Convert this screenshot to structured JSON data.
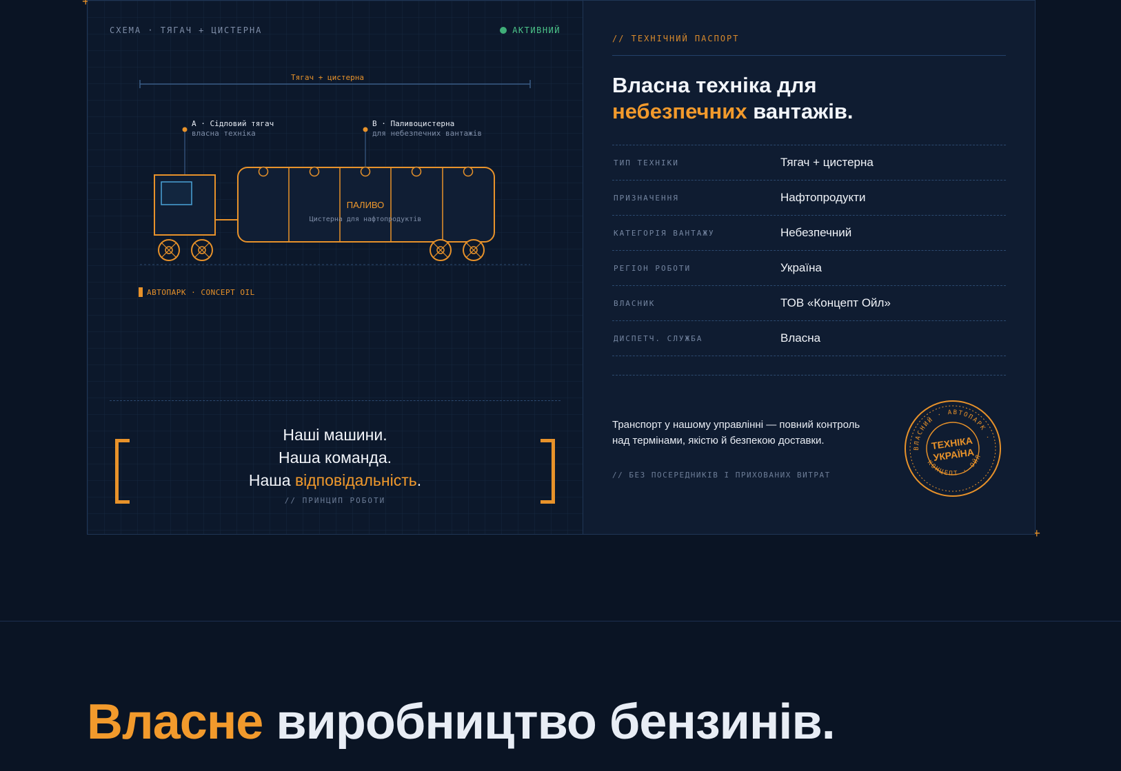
{
  "schema": {
    "label": "СХЕМА · ТЯГАЧ + ЦИСТЕРНА",
    "status": "АКТИВНИЙ",
    "span_label": "Тягач + цистерна",
    "callout_a_title": "A · Сідловий тягач",
    "callout_a_sub": "власна техніка",
    "callout_b_title": "B · Паливоцистерна",
    "callout_b_sub": "для небезпечних вантажів",
    "tank_title": "ПАЛИВО",
    "tank_sub": "Цистерна для нафтопродуктів",
    "fleet_tag": "АВТОПАРК · CONCEPT OIL"
  },
  "motto": {
    "line1": "Наші машини.",
    "line2": "Наша команда.",
    "line3_prefix": "Наша ",
    "line3_accent": "відповідальність",
    "line3_suffix": ".",
    "sub": "// ПРИНЦИП РОБОТИ"
  },
  "passport": {
    "tag": "// ТЕХНІЧНИЙ ПАСПОРТ",
    "heading_line1": "Власна техніка для",
    "heading_accent": "небезпечних",
    "heading_rest": " вантажів.",
    "specs": [
      {
        "key": "ТИП ТЕХНІКИ",
        "value": "Тягач + цистерна"
      },
      {
        "key": "ПРИЗНАЧЕННЯ",
        "value": "Нафтопродукти"
      },
      {
        "key": "КАТЕГОРІЯ ВАНТАЖУ",
        "value": "Небезпечний"
      },
      {
        "key": "РЕГІОН РОБОТИ",
        "value": "Україна"
      },
      {
        "key": "ВЛАСНИК",
        "value": "ТОВ «Концепт Ойл»"
      },
      {
        "key": "ДИСПЕТЧ. СЛУЖБА",
        "value": "Власна"
      }
    ],
    "note": "Транспорт у нашому управлінні — повний контроль над термінами, якістю й безпекою доставки.",
    "note_sub": "// БЕЗ ПОСЕРЕДНИКІВ І ПРИХОВАНИХ ВИТРАТ"
  },
  "stamp": {
    "top_arc": "ВЛАСНИЙ · АВТОПАРК ·",
    "bottom_arc": "КОНЦЕПТ · ОЙЛ",
    "line1": "ТЕХНІКА",
    "line2": "УКРАЇНА"
  },
  "section": {
    "accent": "Власне",
    "rest": " виробництво бензинів."
  },
  "colors": {
    "accent": "#f29a2c",
    "status": "#3fae78",
    "background": "#0a1424",
    "panel": "#0f1c31"
  }
}
